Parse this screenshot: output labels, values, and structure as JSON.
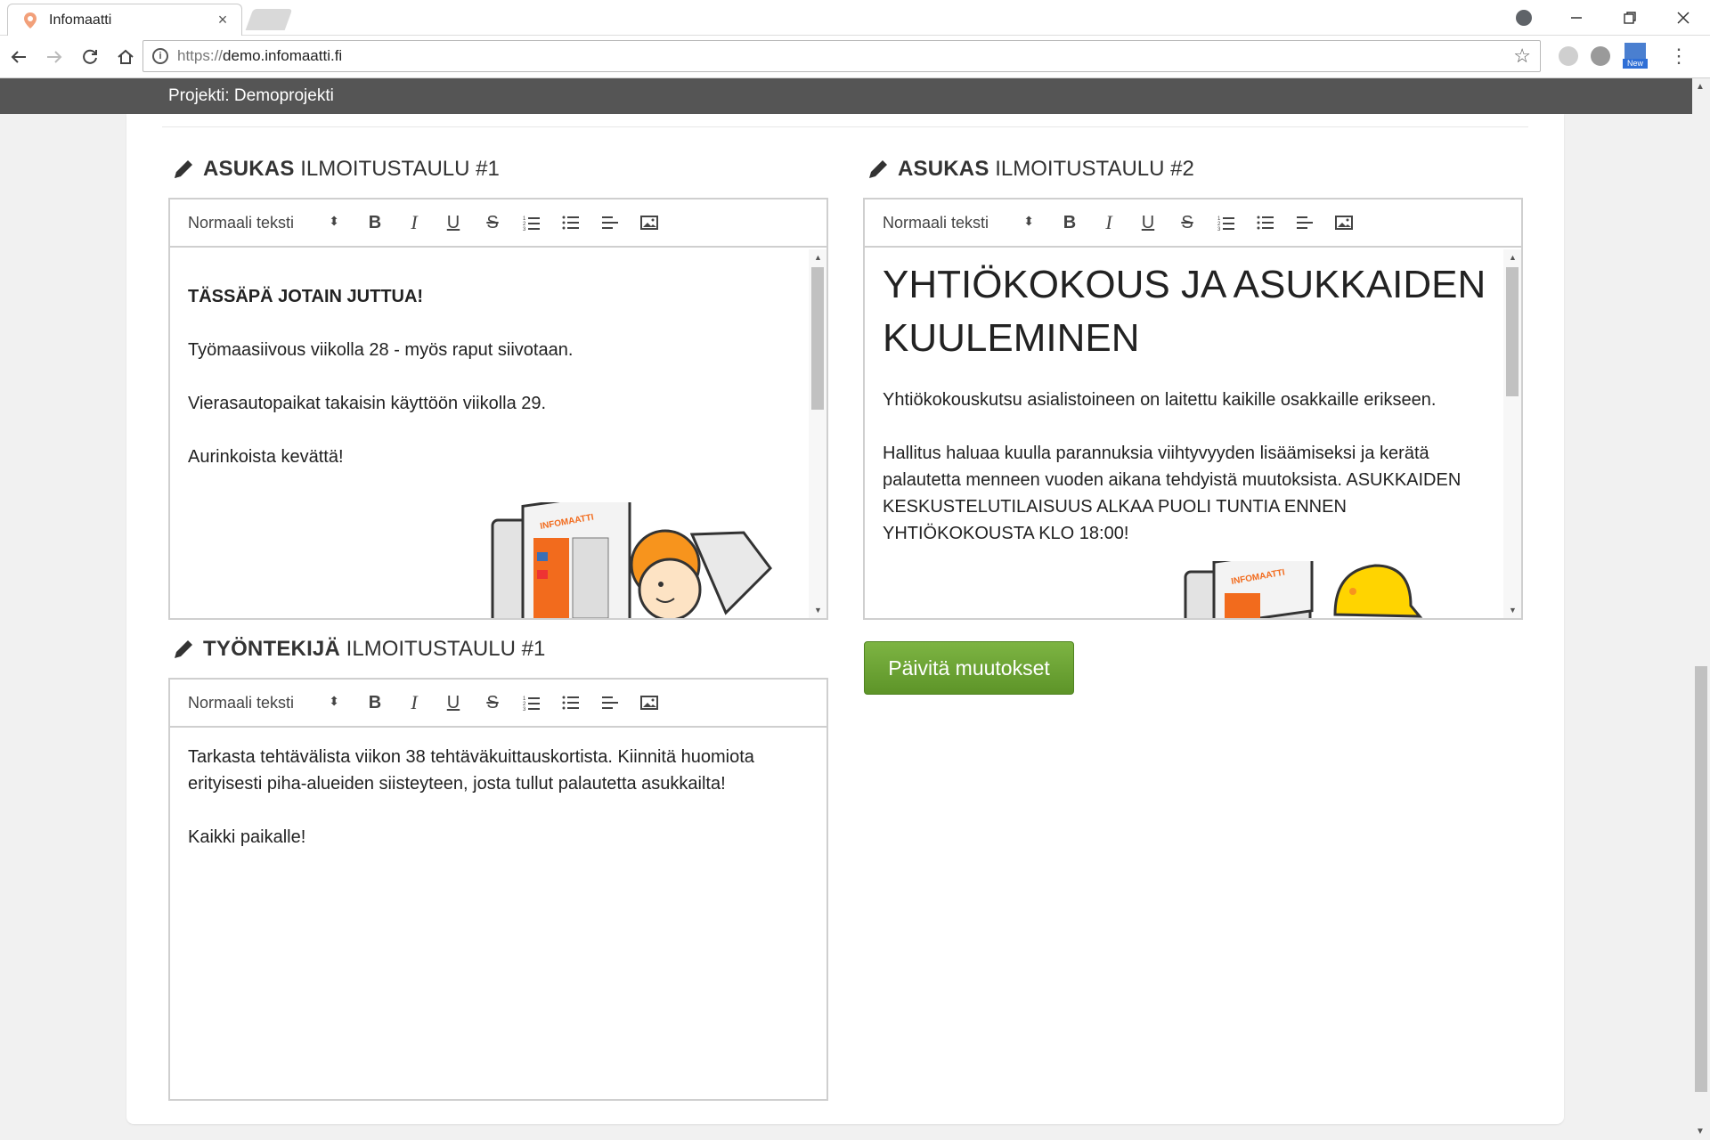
{
  "browser": {
    "tab_title": "Infomaatti",
    "tab_close": "×",
    "url_scheme": "https://",
    "url_host": "demo.infomaatti.fi",
    "ext_new_label": "New"
  },
  "page": {
    "project_title": "Projekti: Demoprojekti"
  },
  "editors": [
    {
      "title_bold": "ASUKAS",
      "title_rest": " ILMOITUSTAULU #1",
      "format_label": "Normaali teksti",
      "content": [
        "TÄSSÄPÄ JOTAIN JUTTUA!",
        "Työmaasiivous viikolla 28 - myös raput siivotaan.",
        "Vierasautopaikat takaisin käyttöön viikolla 29.",
        "Aurinkoista kevättä!"
      ]
    },
    {
      "title_bold": "ASUKAS",
      "title_rest": " ILMOITUSTAULU #2",
      "format_label": "Normaali teksti",
      "heading": "YHTIÖKOKOUS JA ASUKKAIDEN KUULEMINEN",
      "content": [
        "Yhtiökokouskutsu asialistoineen on laitettu kaikille osakkaille erikseen.",
        "Hallitus haluaa kuulla parannuksia viihtyvyyden lisäämiseksi ja kerätä palautetta menneen vuoden aikana tehdyistä muutoksista. ASUKKAIDEN KESKUSTELUTILAISUUS ALKAA PUOLI TUNTIA ENNEN YHTIÖKOKOUSTA KLO 18:00!"
      ]
    },
    {
      "title_bold": "TYÖNTEKIJÄ",
      "title_rest": " ILMOITUSTAULU #1",
      "format_label": "Normaali teksti",
      "content": [
        "Tarkasta tehtävälista viikon 38 tehtäväkuittauskortista.  Kiinnitä huomiota erityisesti piha-alueiden siisteyteen, josta tullut palautetta asukkailta!",
        "Kaikki paikalle!"
      ]
    }
  ],
  "toolbar_buttons": {
    "bold": "B",
    "italic": "I",
    "underline": "U",
    "strike": "S"
  },
  "illustration_text": "INFOMAATTI",
  "update_button": "Päivitä muutokset",
  "colors": {
    "project_bar": "#555555",
    "update_button": "#6fa33a",
    "accent_orange": "#f26b1d"
  }
}
